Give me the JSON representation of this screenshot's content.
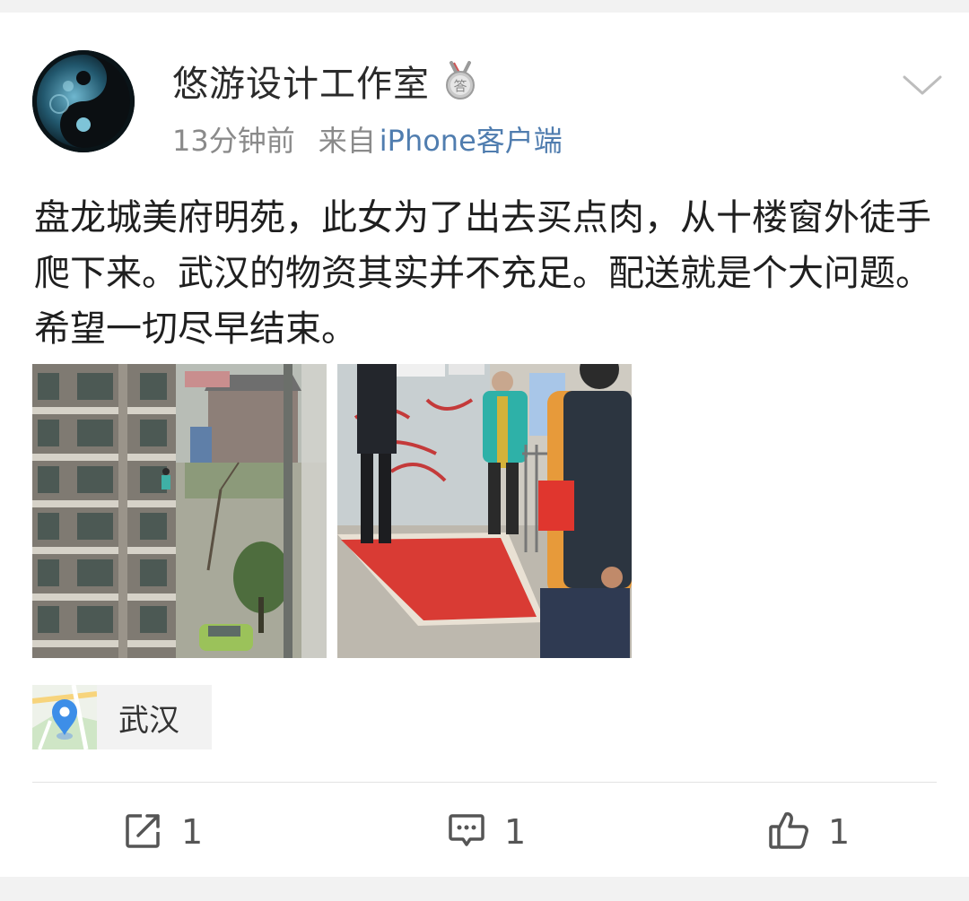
{
  "post": {
    "username": "悠游设计工作室",
    "time": "13分钟前",
    "source_prefix": "来自",
    "source": "iPhone客户端",
    "text": "盘龙城美府明苑，此女为了出去买点肉，从十楼窗外徒手爬下来。武汉的物资其实并不充足。配送就是个大问题。希望一切尽早结束。",
    "location": "武汉"
  },
  "actions": {
    "repost_count": "1",
    "comment_count": "1",
    "like_count": "1"
  },
  "icons": {
    "medal": "answer-medal-icon",
    "chevron": "chevron-down-icon",
    "location": "location-pin-icon",
    "repost": "repost-icon",
    "comment": "comment-icon",
    "like": "thumbs-up-icon"
  },
  "colors": {
    "source_link": "#507daf",
    "location_pin": "#3d8ee8",
    "text": "#1f1f1f",
    "meta": "#8a8a8a"
  }
}
